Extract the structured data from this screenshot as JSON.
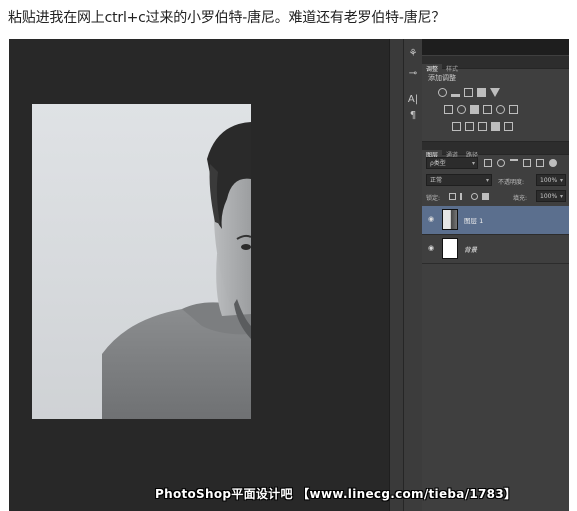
{
  "caption": "粘贴进我在网上ctrl+c过来的小罗伯特-唐尼。难道还有老罗伯特-唐尼？",
  "watermark": "PhotoShop平面设计吧 【www.linecg.com/tieba/1783】",
  "adjustments_panel": {
    "tabs": [
      "调整",
      "样式"
    ],
    "title": "添加调整"
  },
  "layers_panel": {
    "tabs": [
      "图层",
      "通道",
      "路径"
    ],
    "filter_label": "ρ类型",
    "blend_mode": "正常",
    "opacity_label": "不透明度:",
    "opacity_value": "100%",
    "lock_label": "锁定:",
    "fill_label": "填充:",
    "fill_value": "100%",
    "layers": [
      {
        "name": "图层 1",
        "selected": true
      },
      {
        "name": "背景",
        "selected": false
      }
    ]
  },
  "colors": {
    "selected_layer": "#5b6f8e",
    "panel_bg": "#3f3f3f",
    "canvas_bg": "#282828"
  }
}
